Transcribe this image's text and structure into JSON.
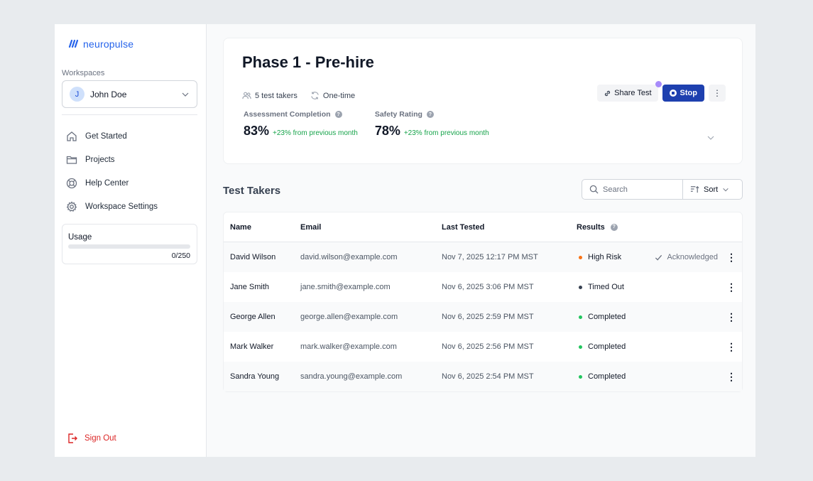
{
  "brand": {
    "logo_mark": "𝘐𝘐",
    "name": "neuropulse"
  },
  "sidebar": {
    "workspaces_label": "Workspaces",
    "workspace": {
      "initial": "J",
      "name": "John Doe"
    },
    "nav": [
      {
        "label": "Get Started",
        "icon": "home-icon"
      },
      {
        "label": "Projects",
        "icon": "folder-icon"
      },
      {
        "label": "Help Center",
        "icon": "lifebuoy-icon"
      },
      {
        "label": "Workspace Settings",
        "icon": "gear-icon"
      }
    ],
    "usage": {
      "label": "Usage",
      "count": "0/250",
      "fraction": 0
    },
    "sign_out": "Sign Out"
  },
  "header": {
    "title": "Phase 1 - Pre-hire",
    "takers": "5 test takers",
    "frequency": "One-time",
    "share_label": "Share Test",
    "stop_label": "Stop",
    "more_label": "⋮",
    "stats": [
      {
        "label": "Assessment Completion",
        "value": "83%",
        "delta": "+23% from previous month"
      },
      {
        "label": "Safety Rating",
        "value": "78%",
        "delta": "+23% from previous month"
      }
    ]
  },
  "section": {
    "title": "Test Takers",
    "search_placeholder": "Search",
    "sort_label": "Sort"
  },
  "table": {
    "columns": [
      "Name",
      "Email",
      "Last Tested",
      "Results"
    ],
    "rows": [
      {
        "name": "David Wilson",
        "email": "david.wilson@example.com",
        "date": "Nov 7, 2025 12:17 PM MST",
        "result": "High Risk",
        "status_color": "#f97316",
        "ack": "Acknowledged"
      },
      {
        "name": "Jane Smith",
        "email": "jane.smith@example.com",
        "date": "Nov 6, 2025 3:06 PM MST",
        "result": "Timed Out",
        "status_color": "#374151",
        "ack": ""
      },
      {
        "name": "George Allen",
        "email": "george.allen@example.com",
        "date": "Nov 6, 2025 2:59 PM MST",
        "result": "Completed",
        "status_color": "#22c55e",
        "ack": ""
      },
      {
        "name": "Mark Walker",
        "email": "mark.walker@example.com",
        "date": "Nov 6, 2025 2:56 PM MST",
        "result": "Completed",
        "status_color": "#22c55e",
        "ack": ""
      },
      {
        "name": "Sandra Young",
        "email": "sandra.young@example.com",
        "date": "Nov 6, 2025 2:54 PM MST",
        "result": "Completed",
        "status_color": "#22c55e",
        "ack": ""
      }
    ]
  },
  "colors": {
    "accent": "#2563eb",
    "stop": "#1e40af",
    "danger": "#dc2626",
    "success": "#16a34a"
  }
}
